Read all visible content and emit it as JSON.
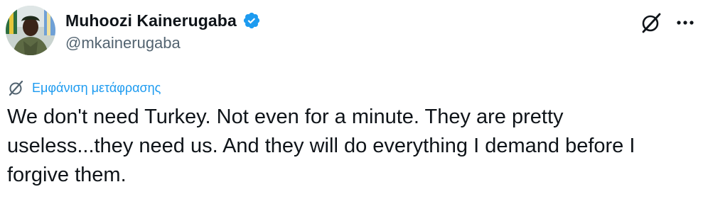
{
  "author": {
    "display_name": "Muhoozi Kainerugaba",
    "handle": "@mkainerugaba",
    "verified": true,
    "avatar_icon": "user-avatar-photo"
  },
  "header_actions": {
    "grok_icon": "grok-slash-circle-icon",
    "more_icon": "more-horizontal-icon"
  },
  "translate": {
    "label": "Εμφάνιση μετάφρασης",
    "icon": "grok-slash-circle-icon"
  },
  "tweet": {
    "text": "We don't need Turkey. Not even for a minute. They are pretty\nuseless...they need us. And they will do everything I demand before I\nforgive them."
  },
  "colors": {
    "text_primary": "#0f1419",
    "text_secondary": "#536471",
    "accent": "#1d9bf0"
  }
}
